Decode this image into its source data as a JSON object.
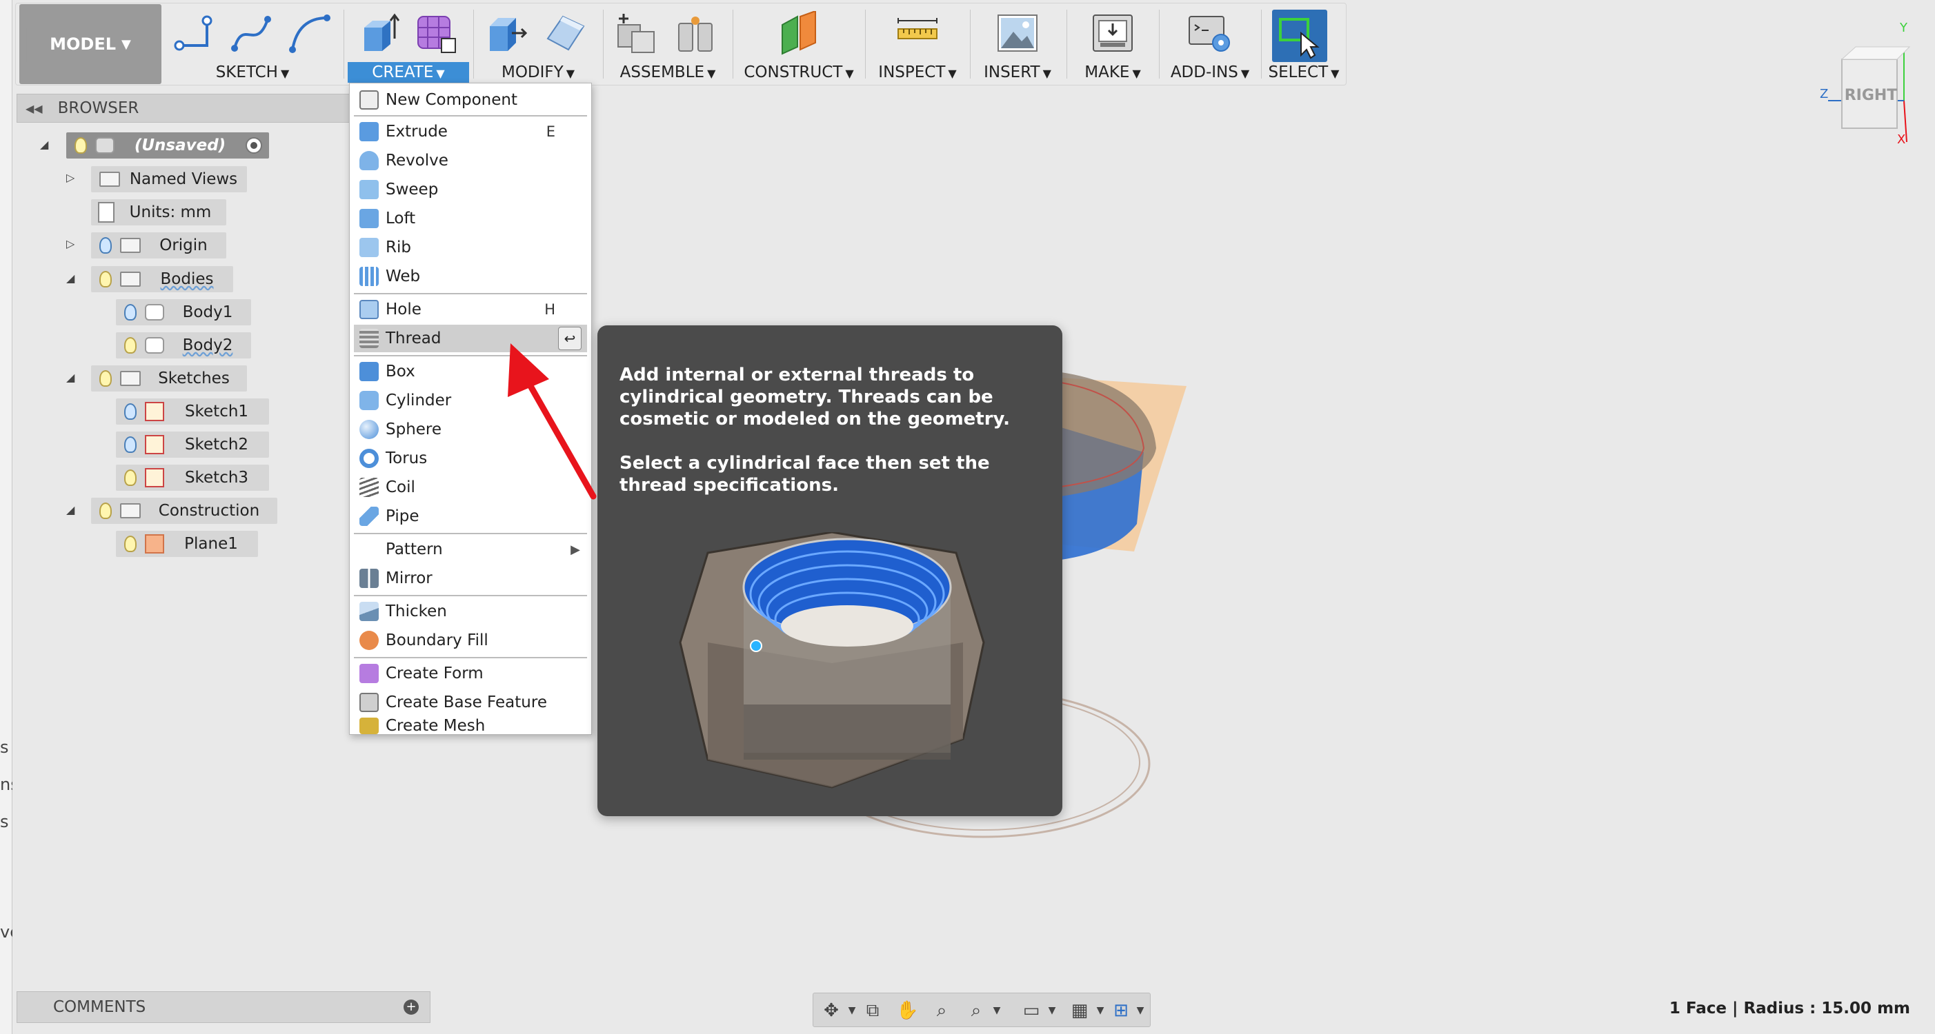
{
  "toolbar": {
    "workspace": "MODEL",
    "groups": {
      "sketch": "SKETCH",
      "create": "CREATE",
      "modify": "MODIFY",
      "assemble": "ASSEMBLE",
      "construct": "CONSTRUCT",
      "inspect": "INSPECT",
      "insert": "INSERT",
      "make": "MAKE",
      "addins": "ADD-INS",
      "select": "SELECT"
    }
  },
  "browser": {
    "title": "BROWSER",
    "root": "(Unsaved)",
    "named_views": "Named Views",
    "units": "Units: mm",
    "origin": "Origin",
    "bodies": "Bodies",
    "body1": "Body1",
    "body2": "Body2",
    "sketches": "Sketches",
    "sketch1": "Sketch1",
    "sketch2": "Sketch2",
    "sketch3": "Sketch3",
    "construction": "Construction",
    "plane1": "Plane1"
  },
  "create_menu": {
    "new_component": "New Component",
    "extrude": "Extrude",
    "extrude_key": "E",
    "revolve": "Revolve",
    "sweep": "Sweep",
    "loft": "Loft",
    "rib": "Rib",
    "web": "Web",
    "hole": "Hole",
    "hole_key": "H",
    "thread": "Thread",
    "box": "Box",
    "cylinder": "Cylinder",
    "sphere": "Sphere",
    "torus": "Torus",
    "coil": "Coil",
    "pipe": "Pipe",
    "pattern": "Pattern",
    "mirror": "Mirror",
    "thicken": "Thicken",
    "boundary_fill": "Boundary Fill",
    "create_form": "Create Form",
    "create_base_feature": "Create Base Feature",
    "create_mesh": "Create Mesh"
  },
  "tooltip": {
    "line1": "Add internal or external threads to cylindrical geometry. Threads can be cosmetic or modeled on the geometry.",
    "line2": "Select a cylindrical face then set the thread specifications."
  },
  "viewcube": {
    "face": "RIGHT",
    "axis_y": "Y",
    "axis_z": "Z",
    "axis_x": "X"
  },
  "left_strip": [
    "s",
    "ns",
    "s",
    "ve"
  ],
  "comments": {
    "title": "COMMENTS"
  },
  "status": {
    "text": "1 Face | Radius : 15.00 mm"
  },
  "colors": {
    "create_active": "#3c8ed6",
    "tooltip_bg": "#4b4b4b",
    "body_blue": "#2e6fd1",
    "plane_orange": "#f6c38a",
    "arrow_red": "#e8141c"
  }
}
